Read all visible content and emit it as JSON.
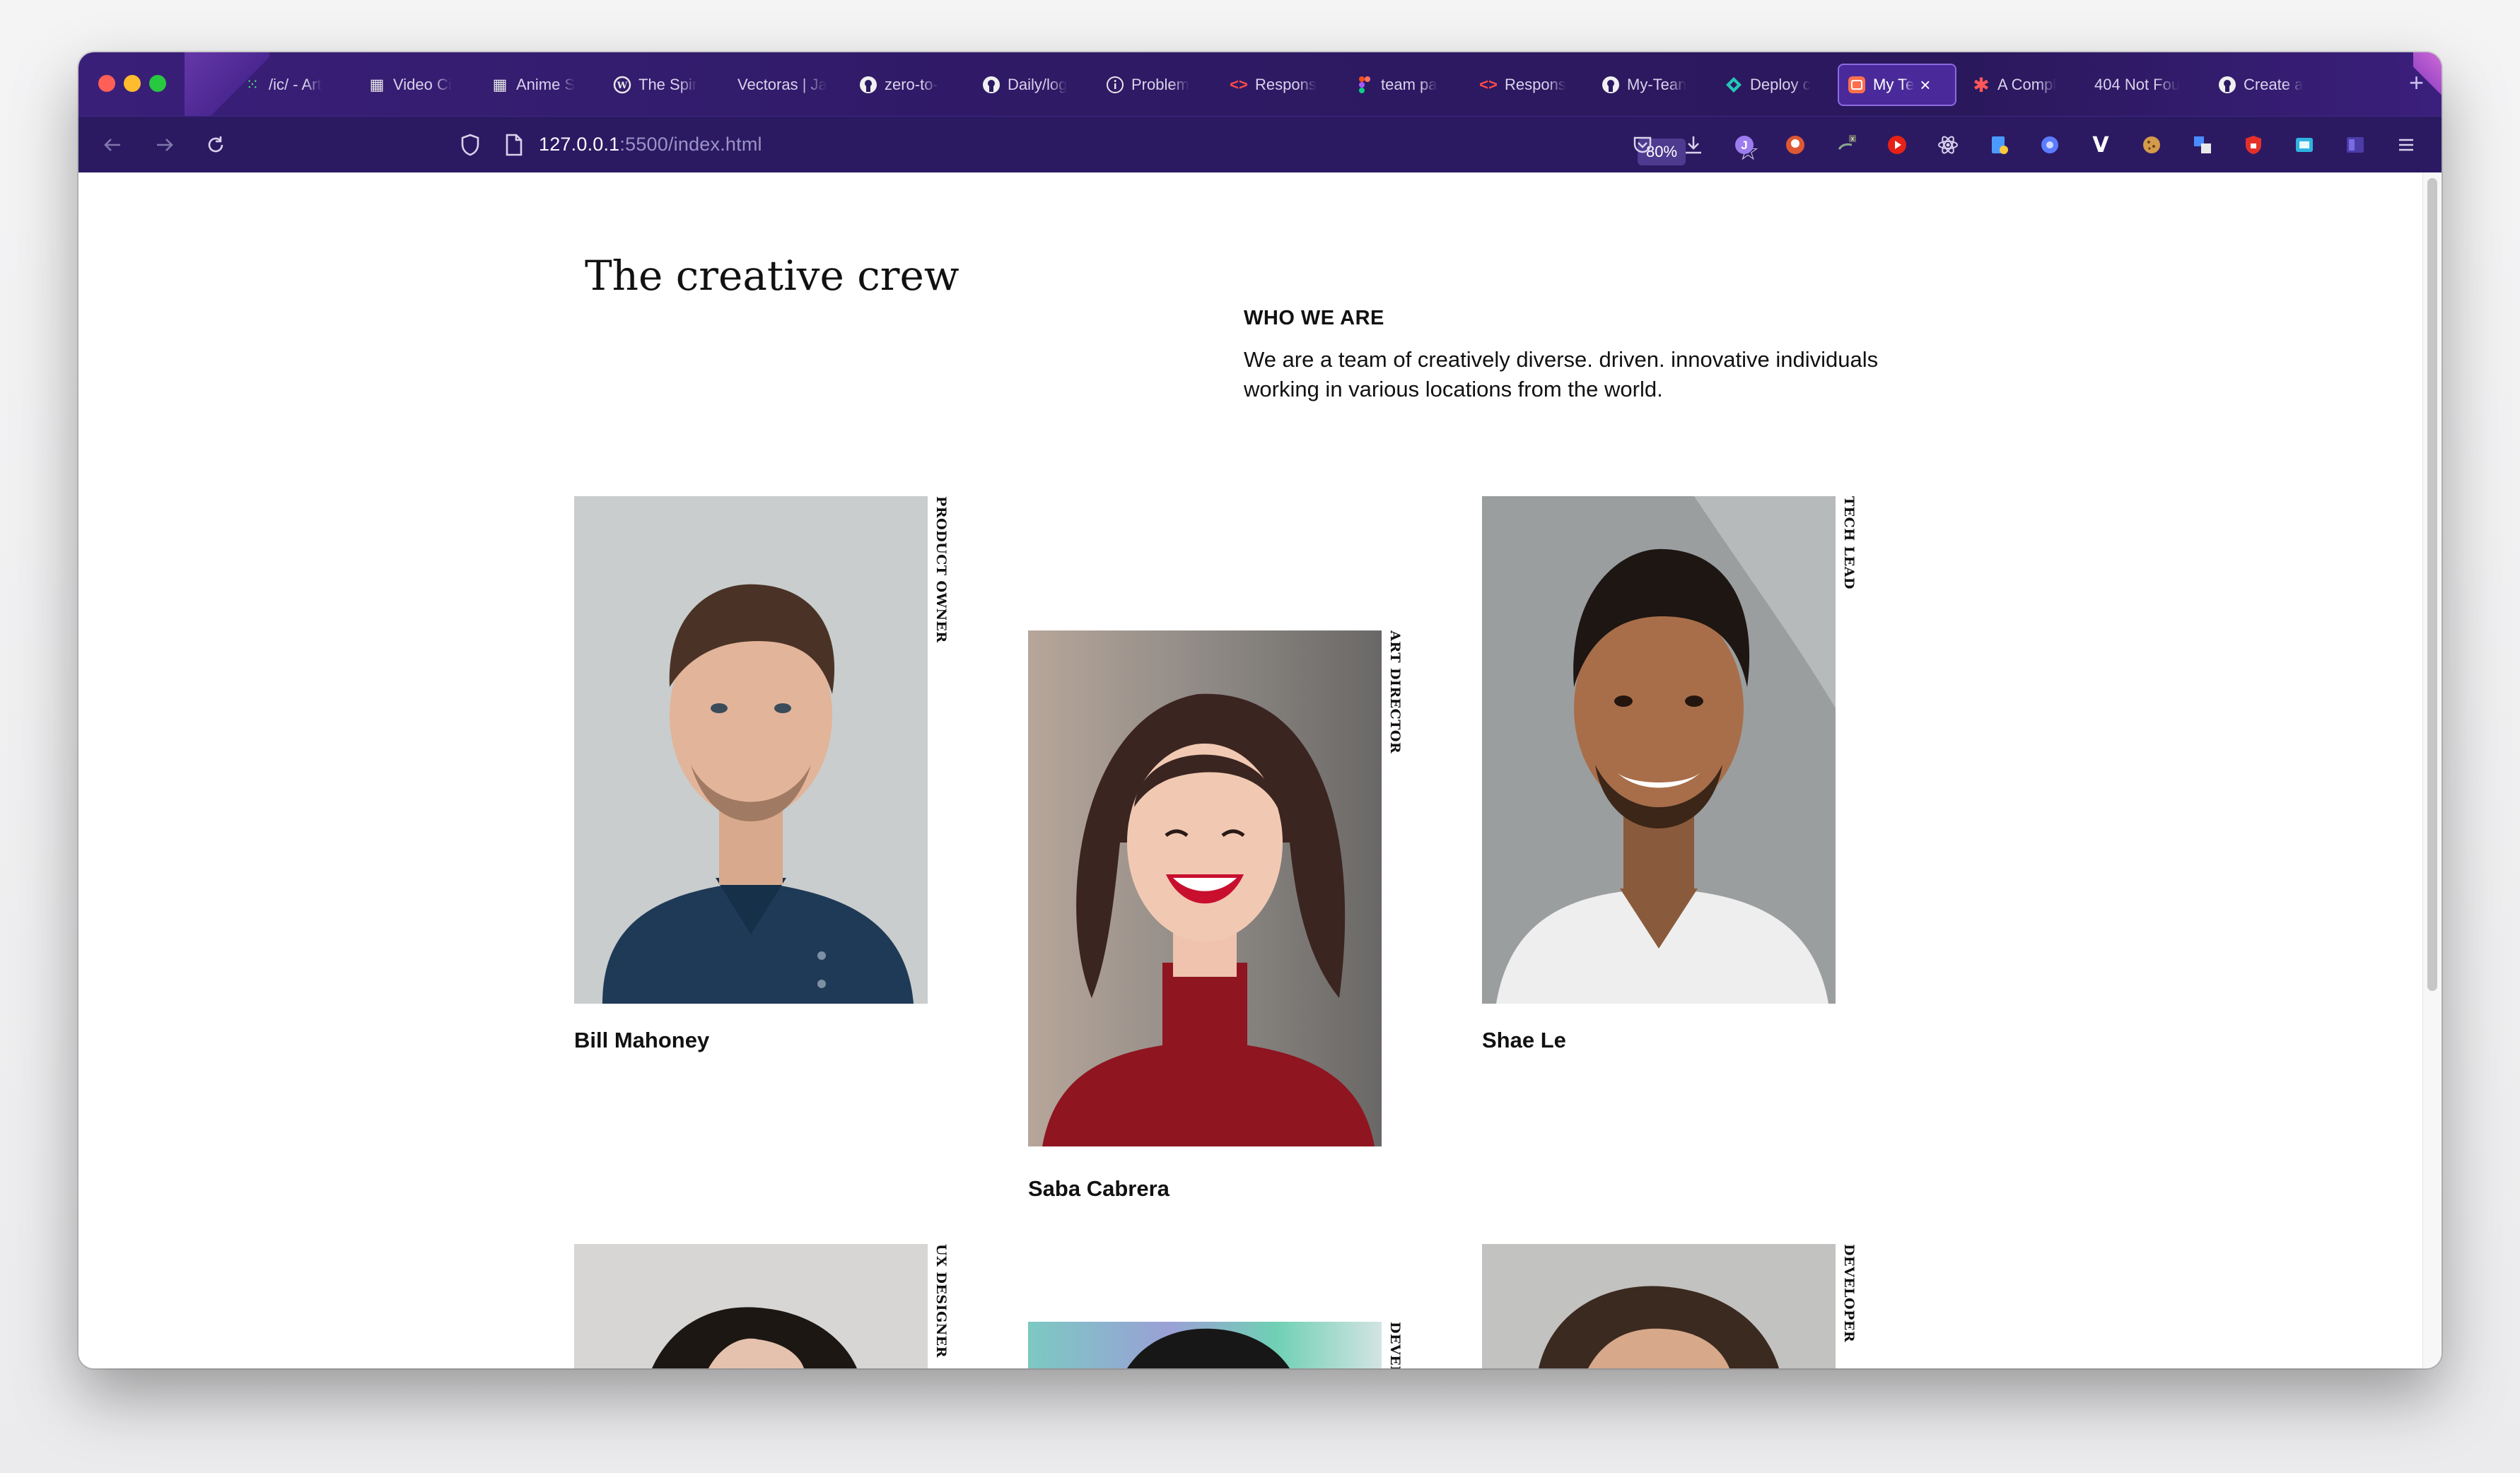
{
  "browser": {
    "tabs": [
      {
        "label": "/ic/ - Art",
        "icon": "grid-icon"
      },
      {
        "label": "Video Ci",
        "icon": "calendar-icon"
      },
      {
        "label": "Anime S",
        "icon": "calendar-icon"
      },
      {
        "label": "The Spir",
        "icon": "wordpress-icon"
      },
      {
        "label": "Vectoras | Ja",
        "icon": "none"
      },
      {
        "label": "zero-to-",
        "icon": "github-icon"
      },
      {
        "label": "Daily/log",
        "icon": "github-icon"
      },
      {
        "label": "Problem",
        "icon": "info-icon"
      },
      {
        "label": "Respons",
        "icon": "code-icon"
      },
      {
        "label": "team pa",
        "icon": "figma-icon"
      },
      {
        "label": "Respons",
        "icon": "code-icon"
      },
      {
        "label": "My-Tean",
        "icon": "github-icon"
      },
      {
        "label": "Deploy c",
        "icon": "diamond-icon"
      },
      {
        "label": "My Te",
        "icon": "app-icon",
        "active": true
      },
      {
        "label": "A Compl",
        "icon": "asterisk-icon"
      },
      {
        "label": "404 Not Fou",
        "icon": "none"
      },
      {
        "label": "Create a",
        "icon": "github-icon"
      }
    ],
    "new_tab": "+",
    "url_host": "127.0.0.1",
    "url_rest": ":5500/index.html",
    "zoom": "80%",
    "colors": {
      "frame": "#2b1a62",
      "active_tab": "#4a2a9a"
    }
  },
  "page": {
    "title": "The creative crew",
    "who_heading": "WHO WE ARE",
    "who_text": "We are a team of creatively diverse. driven. innovative individuals working in various locations from the world.",
    "members": [
      {
        "name": "Bill Mahoney",
        "role": "PRODUCT OWNER"
      },
      {
        "name": "Saba Cabrera",
        "role": "ART DIRECTOR"
      },
      {
        "name": "Shae Le",
        "role": "TECH LEAD"
      },
      {
        "name": "",
        "role": "UX DESIGNER"
      },
      {
        "name": "",
        "role": "DEVELOPER"
      },
      {
        "name": "",
        "role": "DEVELOPER"
      }
    ]
  }
}
